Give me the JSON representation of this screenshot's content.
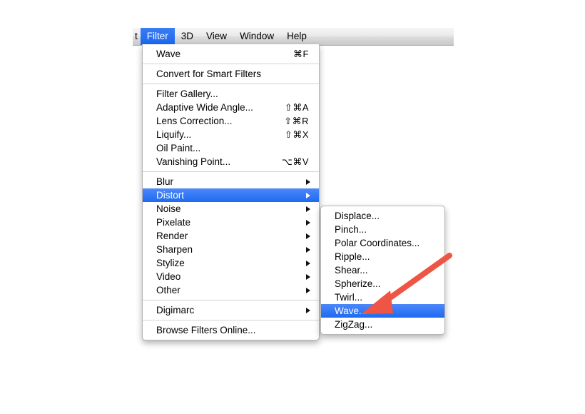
{
  "menubar": {
    "items": [
      {
        "label": "t",
        "active": false,
        "truncated": true
      },
      {
        "label": "Filter",
        "active": true,
        "truncated": false
      },
      {
        "label": "3D",
        "active": false,
        "truncated": false
      },
      {
        "label": "View",
        "active": false,
        "truncated": false
      },
      {
        "label": "Window",
        "active": false,
        "truncated": false
      },
      {
        "label": "Help",
        "active": false,
        "truncated": false
      }
    ]
  },
  "filter_menu": {
    "rows": [
      {
        "type": "item",
        "label": "Wave",
        "shortcut": "⌘F",
        "submenu": false,
        "highlight": false
      },
      {
        "type": "separator"
      },
      {
        "type": "item",
        "label": "Convert for Smart Filters",
        "shortcut": "",
        "submenu": false,
        "highlight": false
      },
      {
        "type": "separator"
      },
      {
        "type": "item",
        "label": "Filter Gallery...",
        "shortcut": "",
        "submenu": false,
        "highlight": false
      },
      {
        "type": "item",
        "label": "Adaptive Wide Angle...",
        "shortcut": "⇧⌘A",
        "submenu": false,
        "highlight": false
      },
      {
        "type": "item",
        "label": "Lens Correction...",
        "shortcut": "⇧⌘R",
        "submenu": false,
        "highlight": false
      },
      {
        "type": "item",
        "label": "Liquify...",
        "shortcut": "⇧⌘X",
        "submenu": false,
        "highlight": false
      },
      {
        "type": "item",
        "label": "Oil Paint...",
        "shortcut": "",
        "submenu": false,
        "highlight": false
      },
      {
        "type": "item",
        "label": "Vanishing Point...",
        "shortcut": "⌥⌘V",
        "submenu": false,
        "highlight": false
      },
      {
        "type": "separator"
      },
      {
        "type": "item",
        "label": "Blur",
        "shortcut": "",
        "submenu": true,
        "highlight": false
      },
      {
        "type": "item",
        "label": "Distort",
        "shortcut": "",
        "submenu": true,
        "highlight": true
      },
      {
        "type": "item",
        "label": "Noise",
        "shortcut": "",
        "submenu": true,
        "highlight": false
      },
      {
        "type": "item",
        "label": "Pixelate",
        "shortcut": "",
        "submenu": true,
        "highlight": false
      },
      {
        "type": "item",
        "label": "Render",
        "shortcut": "",
        "submenu": true,
        "highlight": false
      },
      {
        "type": "item",
        "label": "Sharpen",
        "shortcut": "",
        "submenu": true,
        "highlight": false
      },
      {
        "type": "item",
        "label": "Stylize",
        "shortcut": "",
        "submenu": true,
        "highlight": false
      },
      {
        "type": "item",
        "label": "Video",
        "shortcut": "",
        "submenu": true,
        "highlight": false
      },
      {
        "type": "item",
        "label": "Other",
        "shortcut": "",
        "submenu": true,
        "highlight": false
      },
      {
        "type": "separator"
      },
      {
        "type": "item",
        "label": "Digimarc",
        "shortcut": "",
        "submenu": true,
        "highlight": false
      },
      {
        "type": "separator"
      },
      {
        "type": "item",
        "label": "Browse Filters Online...",
        "shortcut": "",
        "submenu": false,
        "highlight": false
      }
    ]
  },
  "distort_submenu": {
    "rows": [
      {
        "type": "item",
        "label": "Displace...",
        "shortcut": "",
        "submenu": false,
        "highlight": false
      },
      {
        "type": "item",
        "label": "Pinch...",
        "shortcut": "",
        "submenu": false,
        "highlight": false
      },
      {
        "type": "item",
        "label": "Polar Coordinates...",
        "shortcut": "",
        "submenu": false,
        "highlight": false
      },
      {
        "type": "item",
        "label": "Ripple...",
        "shortcut": "",
        "submenu": false,
        "highlight": false
      },
      {
        "type": "item",
        "label": "Shear...",
        "shortcut": "",
        "submenu": false,
        "highlight": false
      },
      {
        "type": "item",
        "label": "Spherize...",
        "shortcut": "",
        "submenu": false,
        "highlight": false
      },
      {
        "type": "item",
        "label": "Twirl...",
        "shortcut": "",
        "submenu": false,
        "highlight": false
      },
      {
        "type": "item",
        "label": "Wave...",
        "shortcut": "",
        "submenu": false,
        "highlight": true
      },
      {
        "type": "item",
        "label": "ZigZag...",
        "shortcut": "",
        "submenu": false,
        "highlight": false
      }
    ]
  },
  "annotation": {
    "arrow_name": "red-pointer-arrow",
    "color": "#ef5544"
  },
  "colors": {
    "highlight_top": "#4d87f8",
    "highlight_bottom": "#1d6bf1",
    "menu_background": "#ffffff",
    "menubar_border": "#a8a8a8",
    "separator": "#d4d4d4",
    "arrow_red": "#ef5544"
  }
}
